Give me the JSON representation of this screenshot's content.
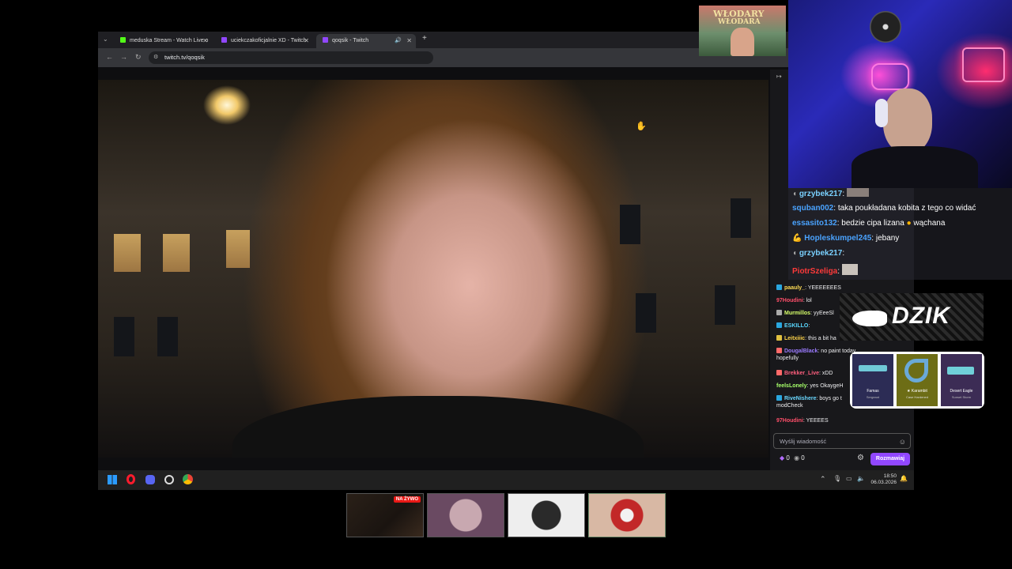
{
  "tabs": [
    {
      "label": "meduska Stream - Watch Live o",
      "color": "#53fc18"
    },
    {
      "label": "uciekczakoficjalnie XD - Twitch",
      "color": "#9147ff"
    },
    {
      "label": "qoqsik - Twitch",
      "color": "#9147ff"
    }
  ],
  "browser": {
    "url": "twitch.tv/qoqsik",
    "new_tab": "+"
  },
  "chat": {
    "messages": [
      {
        "user": "paauly_",
        "text": "YEEEEEEES",
        "color": "#ffdd55"
      },
      {
        "user": "97Houdini",
        "text": "lol",
        "color": "#ff4f6a"
      },
      {
        "user": "Murmillos",
        "text": "yyEeeSl",
        "color": "#d6ff6a"
      },
      {
        "user": "ESKILLO",
        "text": "",
        "color": "#5ad8ff"
      },
      {
        "user": "Leitxiiic",
        "text": "this a bit ha",
        "color": "#ffd54a"
      },
      {
        "user": "DougalBlack",
        "text": "no paint today hopefully",
        "color": "#9b7bff"
      },
      {
        "user": "Brekker_Live",
        "text": "xDD",
        "color": "#ff5f7e"
      },
      {
        "user": "feelsLonely",
        "text": "yes OkaygeH",
        "color": "#a6ff6a"
      },
      {
        "user": "RiveNishere",
        "text": "boys go t modCheck",
        "color": "#6ad8ff"
      },
      {
        "user": "97Houdini",
        "text": "YEEEES",
        "color": "#ff4f6a"
      }
    ],
    "input_placeholder": "Wyślij wiadomość",
    "points_a": "0",
    "points_b": "0",
    "send_label": "Rozmawiaj"
  },
  "taskbar": {
    "time": "18:50",
    "date": "06.03.2026"
  },
  "overlay": {
    "poster_text_1": "WŁODARY",
    "poster_text_2": "WŁODARA",
    "chat": [
      {
        "user": "grzybek217",
        "text": "",
        "color": "#7ad1ff"
      },
      {
        "user": "squban002",
        "text": "taka poukładana kobita z tego co widać",
        "color": "#4aa3ff"
      },
      {
        "user": "essasito132",
        "text": "bedzie cipa lizana",
        "extra": "wąchana",
        "color": "#4aa3ff"
      },
      {
        "user": "Hopleskumpel245",
        "text": "jebany",
        "color": "#4aa3ff"
      },
      {
        "user": "grzybek217",
        "text": "",
        "color": "#7ad1ff"
      },
      {
        "user": "PiotrSzeliga",
        "text": "",
        "color": "#ff3a3a"
      }
    ],
    "dzik": "DZIK",
    "skins": [
      {
        "name": "Famas",
        "sub": "Sergeant",
        "color": "#5b5b8a"
      },
      {
        "name": "★ Karambit",
        "sub": "Case Hardened",
        "color": "#8a8a2a"
      },
      {
        "name": "Desert Eagle",
        "sub": "Sunset Storm",
        "color": "#6a4a8a"
      }
    ],
    "live_badge": "NA ŻYWO"
  }
}
